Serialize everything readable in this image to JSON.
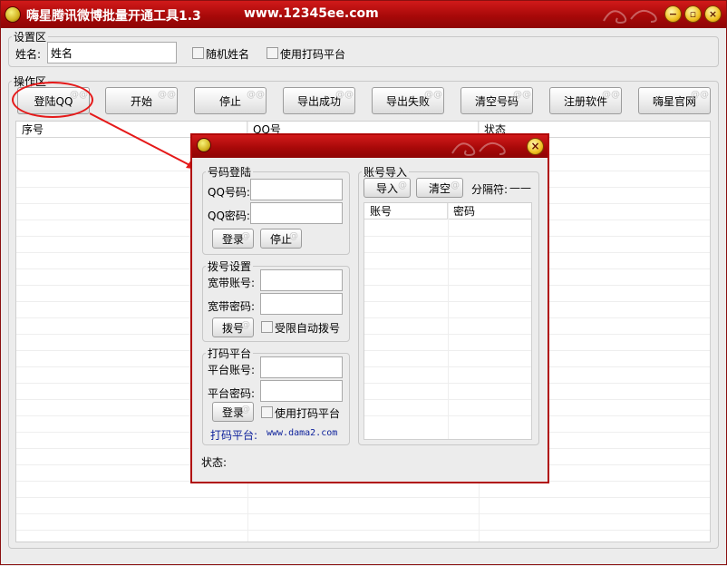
{
  "window": {
    "title": "嗨星腾讯微博批量开通工具1.3",
    "site": "www.12345ee.com"
  },
  "settings": {
    "legend": "设置区",
    "name_label": "姓名:",
    "name_value": "姓名",
    "random_name_label": "随机姓名",
    "use_captcha_label": "使用打码平台"
  },
  "operations": {
    "legend": "操作区",
    "buttons": [
      "登陆QQ",
      "开始",
      "停止",
      "导出成功",
      "导出失败",
      "清空号码",
      "注册软件",
      "嗨星官网"
    ]
  },
  "main_list": {
    "columns": [
      "序号",
      "QQ号",
      "状态"
    ]
  },
  "dialog": {
    "qq_login": {
      "legend": "号码登陆",
      "qq_label": "QQ号码:",
      "pwd_label": "QQ密码:",
      "login_btn": "登录",
      "stop_btn": "停止"
    },
    "dial": {
      "legend": "拨号设置",
      "account_label": "宽带账号:",
      "pwd_label": "宽带密码:",
      "dial_btn": "拨号",
      "auto_dial_label": "受限自动拨号"
    },
    "captcha": {
      "legend": "打码平台",
      "account_label": "平台账号:",
      "pwd_label": "平台密码:",
      "login_btn": "登录",
      "use_label": "使用打码平台",
      "platform_label": "打码平台:",
      "platform_url": "www.dama2.com"
    },
    "status_label": "状态:",
    "import": {
      "legend": "账号导入",
      "import_btn": "导入",
      "clear_btn": "清空",
      "separator_label": "分隔符:",
      "separator_value": "——",
      "columns": [
        "账号",
        "密码"
      ]
    }
  },
  "colors": {
    "title_red": "#b00808",
    "annotation_red": "#e51919",
    "link_blue": "#0a1e9a"
  }
}
